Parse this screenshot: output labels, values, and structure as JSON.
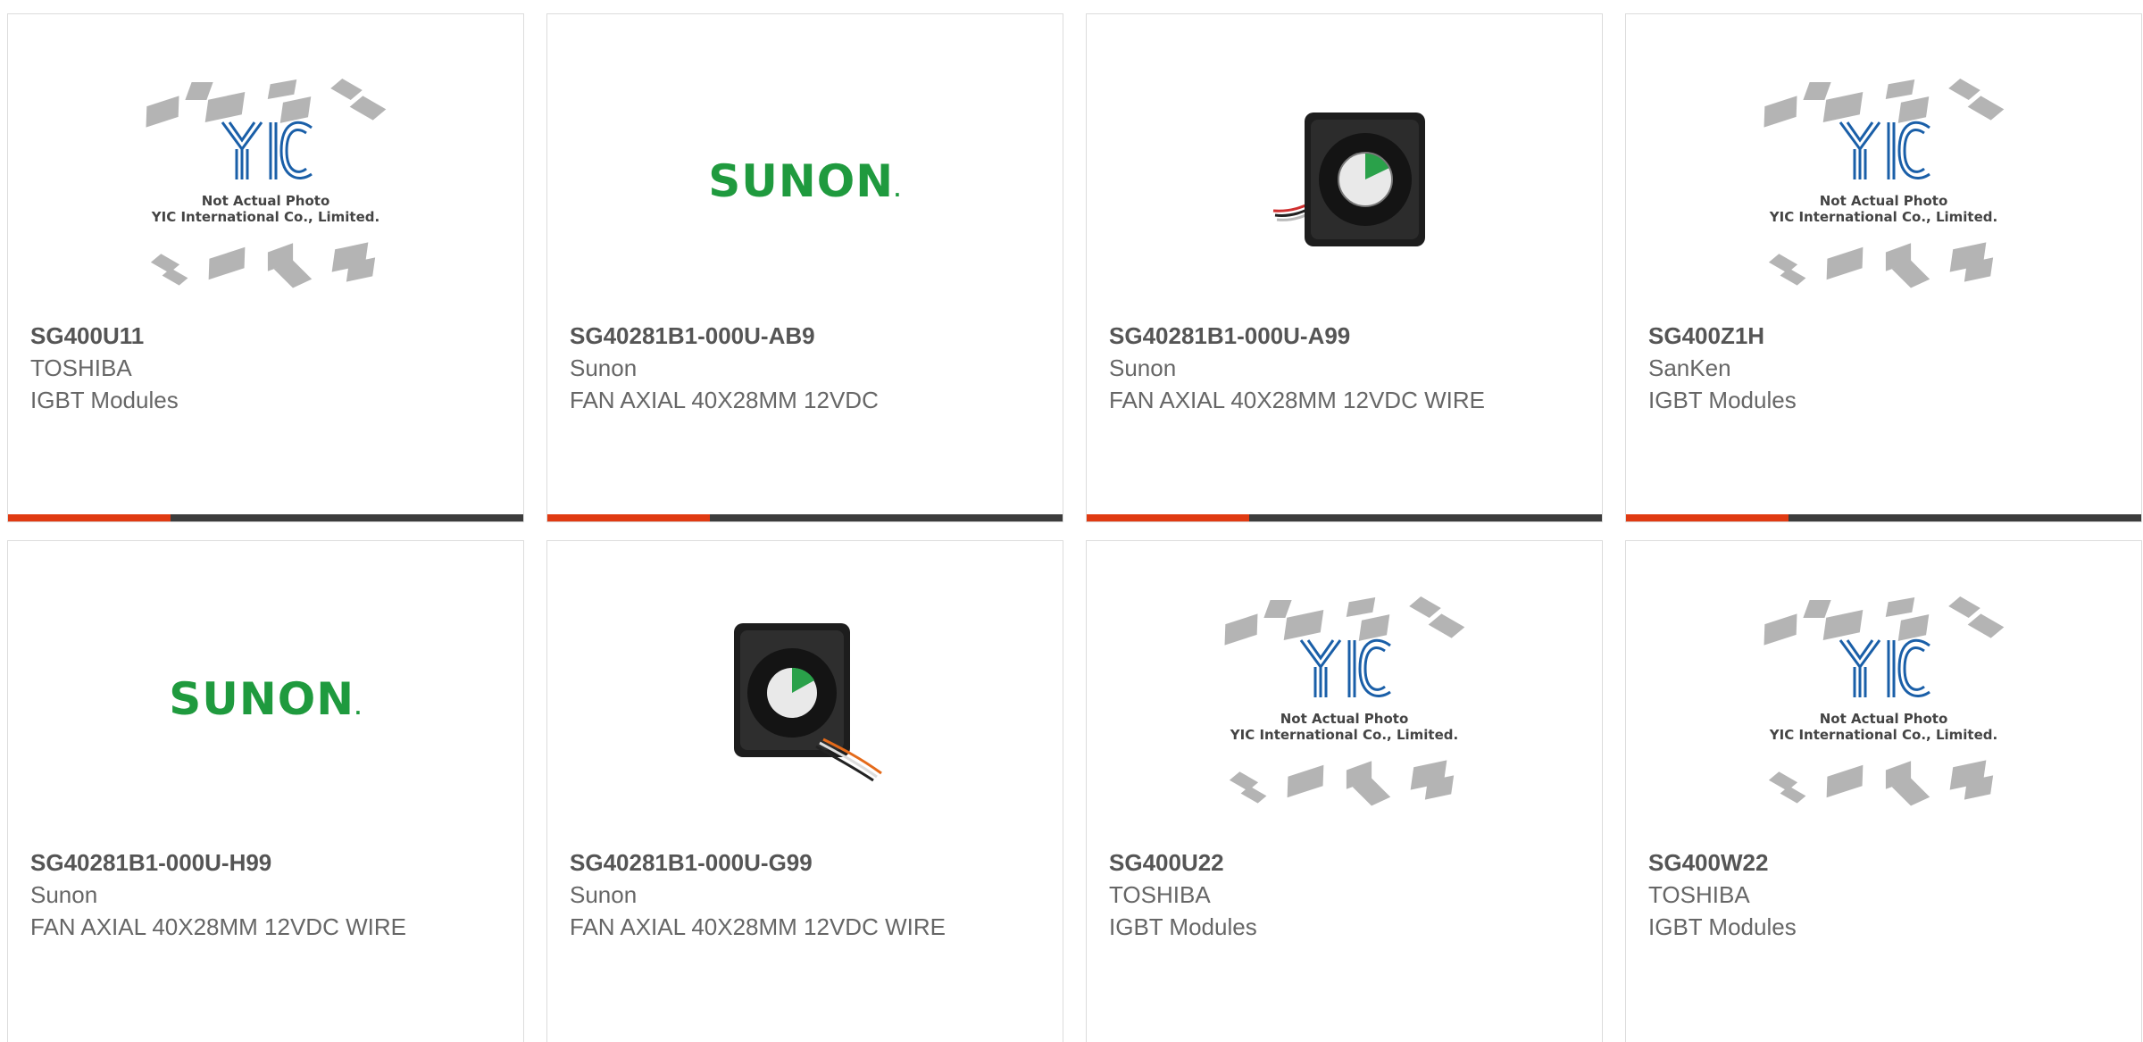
{
  "products": [
    {
      "part_number": "SG400U11",
      "manufacturer": "TOSHIBA",
      "description": "IGBT Modules",
      "image": "yic-placeholder",
      "placeholder_caption": [
        "Not Actual Photo",
        "YIC International Co., Limited."
      ]
    },
    {
      "part_number": "SG40281B1-000U-AB9",
      "manufacturer": "Sunon",
      "description": "FAN AXIAL 40X28MM 12VDC",
      "image": "sunon-logo",
      "logo_text": "SUNON",
      "logo_dot": "."
    },
    {
      "part_number": "SG40281B1-000U-A99",
      "manufacturer": "Sunon",
      "description": "FAN AXIAL 40X28MM 12VDC WIRE",
      "image": "fan-photo"
    },
    {
      "part_number": "SG400Z1H",
      "manufacturer": "SanKen",
      "description": "IGBT Modules",
      "image": "yic-placeholder",
      "placeholder_caption": [
        "Not Actual Photo",
        "YIC International Co., Limited."
      ]
    },
    {
      "part_number": "SG40281B1-000U-H99",
      "manufacturer": "Sunon",
      "description": "FAN AXIAL 40X28MM 12VDC WIRE",
      "image": "sunon-logo",
      "logo_text": "SUNON",
      "logo_dot": "."
    },
    {
      "part_number": "SG40281B1-000U-G99",
      "manufacturer": "Sunon",
      "description": "FAN AXIAL 40X28MM 12VDC WIRE",
      "image": "fan-photo"
    },
    {
      "part_number": "SG400U22",
      "manufacturer": "TOSHIBA",
      "description": "IGBT Modules",
      "image": "yic-placeholder",
      "placeholder_caption": [
        "Not Actual Photo",
        "YIC International Co., Limited."
      ]
    },
    {
      "part_number": "SG400W22",
      "manufacturer": "TOSHIBA",
      "description": "IGBT Modules",
      "image": "yic-placeholder",
      "placeholder_caption": [
        "Not Actual Photo",
        "YIC International Co., Limited."
      ]
    }
  ],
  "colors": {
    "accent": "#e03a12",
    "bar": "#3c3c3c",
    "sunon_green": "#1f9a3e",
    "yic_blue": "#1a5fa8"
  }
}
